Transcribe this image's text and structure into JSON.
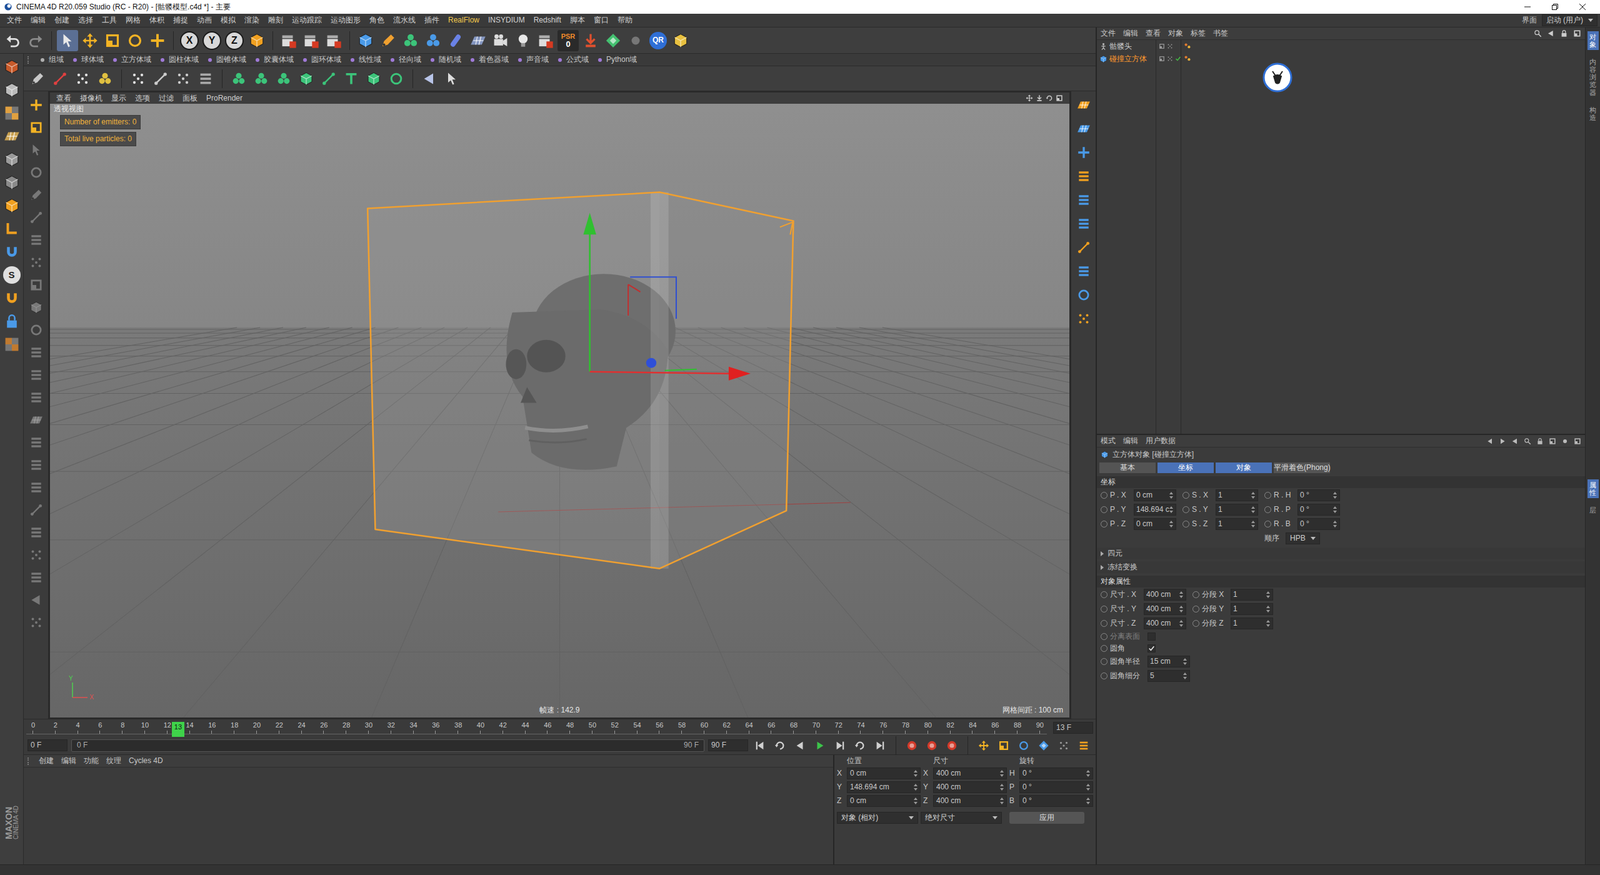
{
  "window": {
    "title": "CINEMA 4D R20.059 Studio (RC - R20) - [骷髅模型.c4d *] - 主要"
  },
  "menu": [
    {
      "label": "文件",
      "highlighted": false
    },
    {
      "label": "编辑",
      "highlighted": false
    },
    {
      "label": "创建",
      "highlighted": false
    },
    {
      "label": "选择",
      "highlighted": false
    },
    {
      "label": "工具",
      "highlighted": false
    },
    {
      "label": "网格",
      "highlighted": false
    },
    {
      "label": "体积",
      "highlighted": false
    },
    {
      "label": "捕捉",
      "highlighted": false
    },
    {
      "label": "动画",
      "highlighted": false
    },
    {
      "label": "模拟",
      "highlighted": false
    },
    {
      "label": "渲染",
      "highlighted": false
    },
    {
      "label": "雕刻",
      "highlighted": false
    },
    {
      "label": "运动跟踪",
      "highlighted": false
    },
    {
      "label": "运动图形",
      "highlighted": false
    },
    {
      "label": "角色",
      "highlighted": false
    },
    {
      "label": "流水线",
      "highlighted": false
    },
    {
      "label": "插件",
      "highlighted": false
    },
    {
      "label": "RealFlow",
      "highlighted": true
    },
    {
      "label": "INSYDIUM",
      "highlighted": false
    },
    {
      "label": "Redshift",
      "highlighted": false
    },
    {
      "label": "脚本",
      "highlighted": false
    },
    {
      "label": "窗口",
      "highlighted": false
    },
    {
      "label": "帮助",
      "highlighted": false
    }
  ],
  "layout_switch": {
    "label": "界面",
    "value": "启动 (用户)"
  },
  "toolbar": {
    "axes": [
      "X",
      "Y",
      "Z"
    ],
    "psr": "PSR",
    "psr_value": "0",
    "qr": "QR"
  },
  "snap_button": "S",
  "logo": [
    "MAXON",
    "CINEMA 4D"
  ],
  "fields_bar": [
    "组域",
    "球体域",
    "立方体域",
    "圆柱体域",
    "圆锥体域",
    "胶囊体域",
    "圆环体域",
    "线性域",
    "径向域",
    "随机域",
    "着色器域",
    "声音域",
    "公式域",
    "Python域"
  ],
  "viewport": {
    "menu": [
      "查看",
      "摄像机",
      "显示",
      "选项",
      "过滤",
      "面板",
      "ProRender"
    ],
    "view_name": "透视视图",
    "hud": [
      "Number of emitters: 0",
      "Total live particles: 0"
    ],
    "fps": "帧速 : 142.9",
    "grid_spacing": "网格间距 : 100 cm",
    "axis_labels": [
      "Y",
      "X"
    ]
  },
  "timeline": {
    "ticks": [
      "0",
      "2",
      "4",
      "6",
      "8",
      "10",
      "12",
      "14",
      "16",
      "18",
      "20",
      "22",
      "24",
      "26",
      "28",
      "30",
      "32",
      "34",
      "36",
      "38",
      "40",
      "42",
      "44",
      "46",
      "48",
      "50",
      "52",
      "54",
      "56",
      "58",
      "60",
      "62",
      "64",
      "66",
      "68",
      "70",
      "72",
      "74",
      "76",
      "78",
      "80",
      "82",
      "84",
      "86",
      "88",
      "90"
    ],
    "current": "13",
    "level": 0.144,
    "frame_readout": "13 F"
  },
  "playback": {
    "current": "0 F",
    "range_start": "0 F",
    "range_end": "90 F",
    "max": "90 F"
  },
  "materials": {
    "menu": [
      "创建",
      "编辑",
      "功能",
      "纹理",
      "Cycles 4D"
    ]
  },
  "coordinates": {
    "headers": [
      "位置",
      "尺寸",
      "旋转"
    ],
    "rows": [
      [
        {
          "axis": "X",
          "value": "0 cm"
        },
        {
          "axis": "X",
          "value": "400 cm"
        },
        {
          "axis": "H",
          "value": "0 °"
        }
      ],
      [
        {
          "axis": "Y",
          "value": "148.694 cm"
        },
        {
          "axis": "Y",
          "value": "400 cm"
        },
        {
          "axis": "P",
          "value": "0 °"
        }
      ],
      [
        {
          "axis": "Z",
          "value": "0 cm"
        },
        {
          "axis": "Z",
          "value": "400 cm"
        },
        {
          "axis": "B",
          "value": "0 °"
        }
      ]
    ],
    "modes": [
      "对象 (相对)",
      "绝对尺寸"
    ],
    "apply": "应用"
  },
  "objects": {
    "menu": [
      "文件",
      "编辑",
      "查看",
      "对象",
      "标签",
      "书签"
    ],
    "items": [
      {
        "name": "骷髅头",
        "kind": "mesh",
        "selected": false
      },
      {
        "name": "碰撞立方体",
        "kind": "cube",
        "selected": true
      }
    ]
  },
  "attributes": {
    "menu": [
      "模式",
      "编辑",
      "用户数据"
    ],
    "title": "立方体对象 [碰撞立方体]",
    "tabs": [
      {
        "label": "基本",
        "selected": false
      },
      {
        "label": "坐标",
        "selected": true
      },
      {
        "label": "对象",
        "selected": true
      },
      {
        "label": "平滑着色(Phong)",
        "selected": false
      }
    ],
    "coord_title": "坐标",
    "coord_rows": [
      [
        {
          "label": "P . X",
          "value": "0 cm"
        },
        {
          "label": "S . X",
          "value": "1"
        },
        {
          "label": "R . H",
          "value": "0 °"
        }
      ],
      [
        {
          "label": "P . Y",
          "value": "148.694 c"
        },
        {
          "label": "S . Y",
          "value": "1"
        },
        {
          "label": "R . P",
          "value": "0 °"
        }
      ],
      [
        {
          "label": "P . Z",
          "value": "0 cm"
        },
        {
          "label": "S . Z",
          "value": "1"
        },
        {
          "label": "R . B",
          "value": "0 °"
        }
      ]
    ],
    "order": {
      "label": "顺序",
      "value": "HPB"
    },
    "groups": [
      "四元",
      "冻结变换"
    ],
    "object_title": "对象属性",
    "object_rows": [
      [
        {
          "label": "尺寸 . X",
          "value": "400 cm"
        },
        {
          "label": "分段 X",
          "value": "1"
        }
      ],
      [
        {
          "label": "尺寸 . Y",
          "value": "400 cm"
        },
        {
          "label": "分段 Y",
          "value": "1"
        }
      ],
      [
        {
          "label": "尺寸 . Z",
          "value": "400 cm"
        },
        {
          "label": "分段 Z",
          "value": "1"
        }
      ]
    ],
    "options": [
      {
        "label": "分离表面",
        "kind": "checkbox",
        "checked": false,
        "disabled": true
      },
      {
        "label": "圆角",
        "kind": "checkbox",
        "checked": true,
        "disabled": false
      },
      {
        "label": "圆角半径",
        "kind": "field",
        "value": "15 cm"
      },
      {
        "label": "圆角细分",
        "kind": "field",
        "value": "5"
      }
    ]
  },
  "side_tabs": [
    {
      "label": "对象",
      "selected": true
    },
    {
      "label": "内容浏览器",
      "selected": false
    },
    {
      "label": "构造",
      "selected": false
    },
    {
      "label": "属性",
      "selected": true
    },
    {
      "label": "层",
      "selected": false
    }
  ]
}
